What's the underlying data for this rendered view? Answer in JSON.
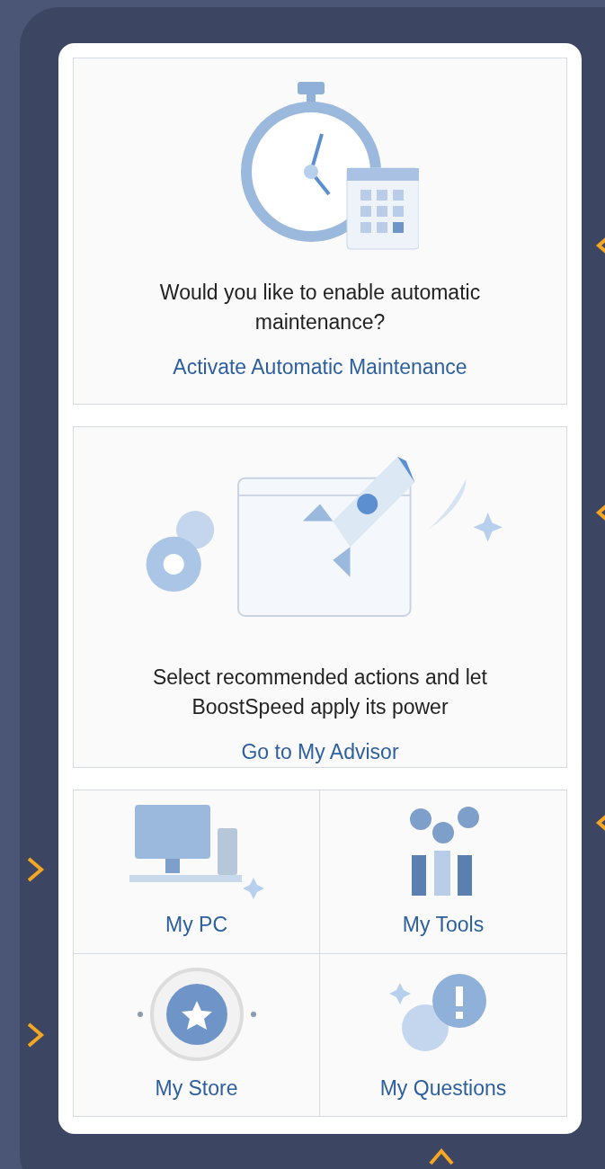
{
  "cards": [
    {
      "kind": "maintenance",
      "message": "Would you like to enable automatic maintenance?",
      "link": "Activate Automatic Maintenance"
    },
    {
      "kind": "advisor",
      "message": "Select recommended actions and let BoostSpeed apply its power",
      "link": "Go to My Advisor"
    }
  ],
  "tiles": [
    {
      "kind": "pc",
      "label": "My PC"
    },
    {
      "kind": "tools",
      "label": "My Tools"
    },
    {
      "kind": "store",
      "label": "My Store"
    },
    {
      "kind": "questions",
      "label": "My Questions"
    }
  ]
}
